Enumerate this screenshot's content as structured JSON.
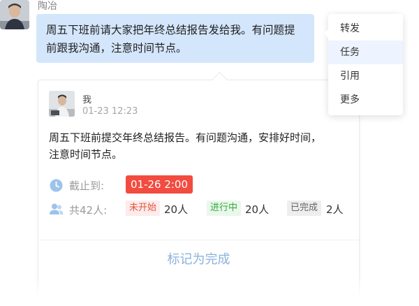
{
  "message": {
    "sender": "陶冶",
    "text_line1": "周五下班前请大家把年终总结报告发给我。有问题提",
    "text_line2": "前跟我沟通，注意时间节点。"
  },
  "context_menu": {
    "items": [
      {
        "label": "转发",
        "active": false
      },
      {
        "label": "任务",
        "active": true
      },
      {
        "label": "引用",
        "active": false
      },
      {
        "label": "更多",
        "active": false
      }
    ]
  },
  "task": {
    "author": "我",
    "time": "01-23 12:23",
    "text_line1": "周五下班前提交年终总结报告。有问题沟通，安排好时间，",
    "text_line2": "注意时间节点。",
    "deadline_label": "截止到:",
    "deadline_value": "01-26 2:00",
    "people_label": "共42人:",
    "statuses": [
      {
        "label": "未开始",
        "count": "20人",
        "color": "#e4543c"
      },
      {
        "label": "进行中",
        "count": "20人",
        "color": "#3aa640"
      },
      {
        "label": "已完成",
        "count": "2人",
        "color": "#666666"
      }
    ],
    "complete_label": "标记为完成"
  },
  "colors": {
    "bubble": "#d4e6fb",
    "deadline_badge": "#f24b3f",
    "icon_blue": "#9cc3ec",
    "complete_text": "#8cb1dc"
  },
  "icons": {
    "clock": "clock-icon",
    "people": "people-icon"
  }
}
